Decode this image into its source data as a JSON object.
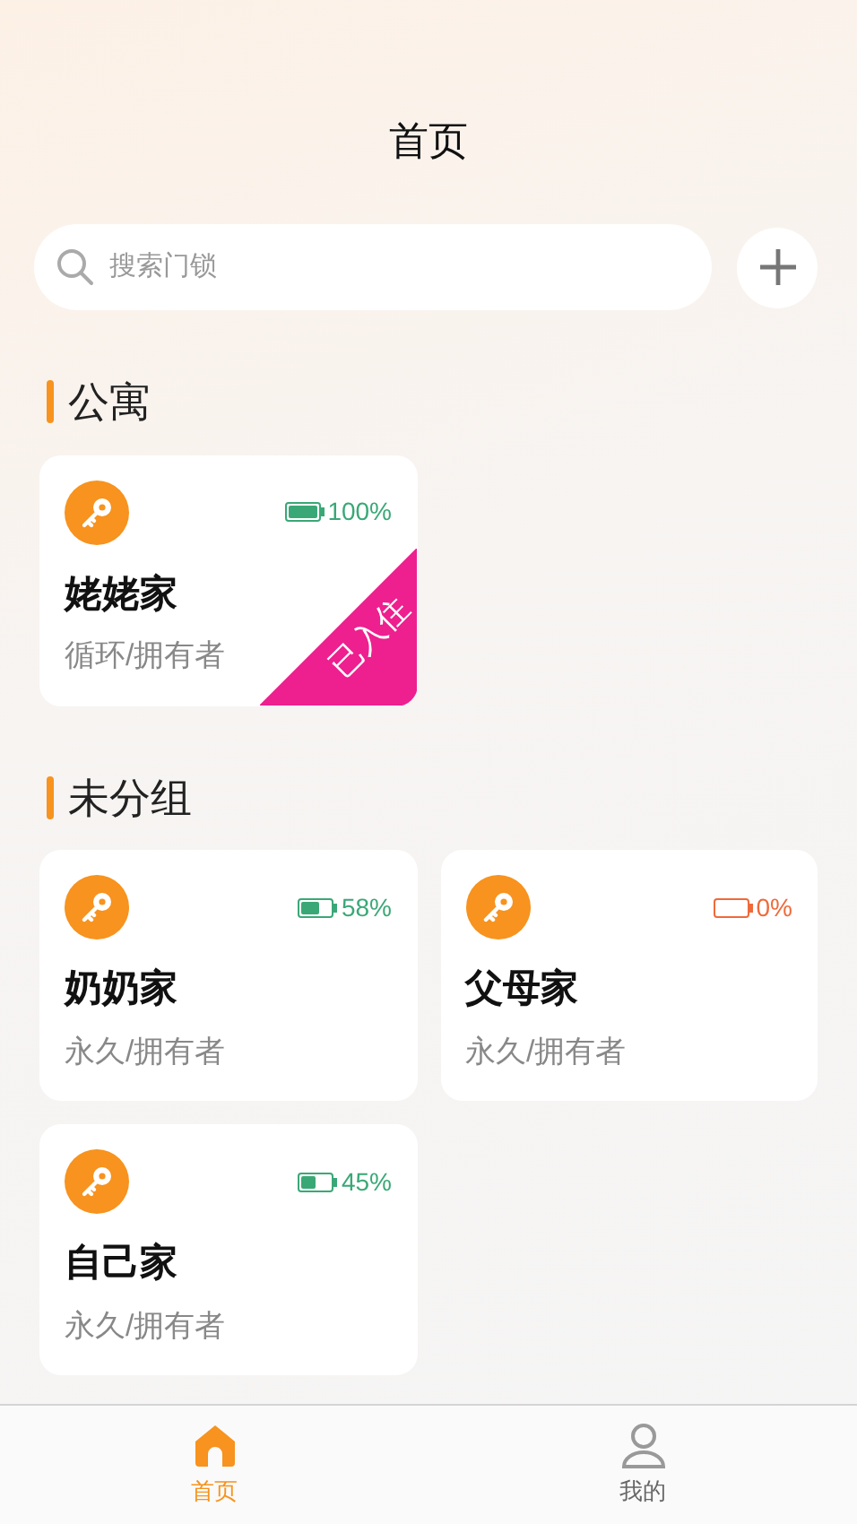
{
  "title": "首页",
  "search": {
    "placeholder": "搜索门锁"
  },
  "groups": [
    {
      "name": "公寓",
      "locks": [
        {
          "name": "姥姥家",
          "mode": "循环/拥有者",
          "battery": {
            "level": 1,
            "reading": "100%",
            "low": false
          },
          "badge": "已入住"
        }
      ]
    },
    {
      "name": "未分组",
      "locks": [
        {
          "name": "奶奶家",
          "mode": "永久/拥有者",
          "battery": {
            "level": 0.58,
            "reading": "58%",
            "low": false
          }
        },
        {
          "name": "父母家",
          "mode": "永久/拥有者",
          "battery": {
            "reading": "0%",
            "low": true
          }
        },
        {
          "name": "自己家",
          "mode": "永久/拥有者",
          "battery": {
            "level": 0.45,
            "reading": "45%",
            "low": false
          }
        }
      ]
    }
  ],
  "tabs": [
    {
      "label": "首页",
      "selected": true,
      "kind": "home"
    },
    {
      "label": "我的",
      "selected": false,
      "kind": "profile"
    }
  ]
}
